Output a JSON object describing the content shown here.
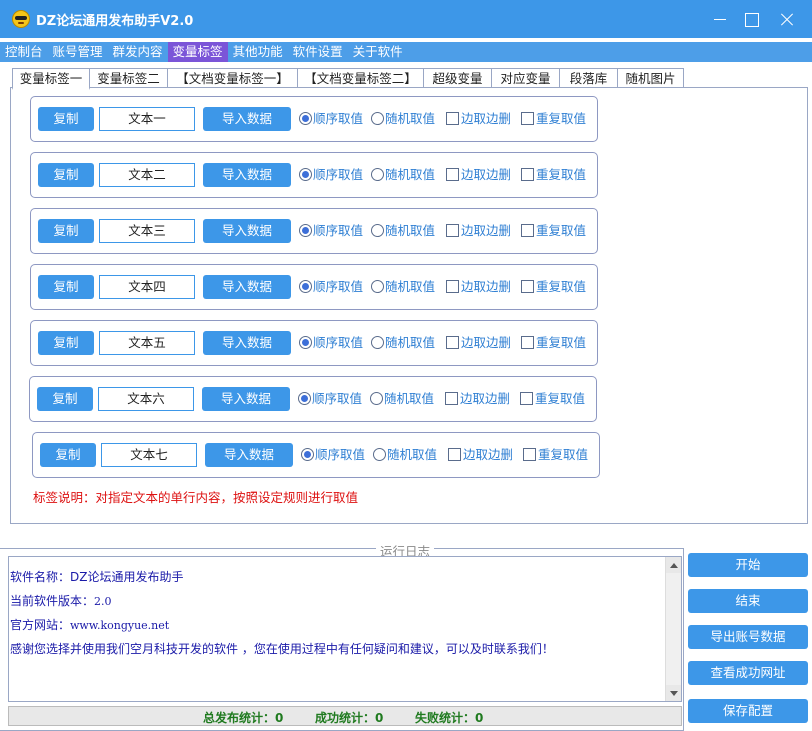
{
  "window": {
    "title": "DZ论坛通用发布助手V2.0"
  },
  "menu": [
    "控制台",
    "账号管理",
    "群发内容",
    "变量标签",
    "其他功能",
    "软件设置",
    "关于软件"
  ],
  "tabs": [
    "变量标签一",
    "变量标签二",
    "【文档变量标签一】",
    "【文档变量标签二】",
    "超级变量",
    "对应变量",
    "段落库",
    "随机图片"
  ],
  "rows": [
    {
      "copy": "复制",
      "text": "文本一",
      "import": "导入数据"
    },
    {
      "copy": "复制",
      "text": "文本二",
      "import": "导入数据"
    },
    {
      "copy": "复制",
      "text": "文本三",
      "import": "导入数据"
    },
    {
      "copy": "复制",
      "text": "文本四",
      "import": "导入数据"
    },
    {
      "copy": "复制",
      "text": "文本五",
      "import": "导入数据"
    },
    {
      "copy": "复制",
      "text": "文本六",
      "import": "导入数据"
    },
    {
      "copy": "复制",
      "text": "文本七",
      "import": "导入数据"
    }
  ],
  "options": {
    "sequential": "顺序取值",
    "random": "随机取值",
    "edges": "边取边删",
    "repeat": "重复取值"
  },
  "hint": "标签说明：对指定文本的单行内容，按照设定规则进行取值",
  "log": {
    "legend": "运行日志",
    "lines": {
      "name_label": "软件名称：",
      "name_value": "DZ论坛通用发布助手",
      "version_label": "当前软件版本：",
      "version_value": "2.0",
      "site_label": "官方网站：",
      "site_value": "www.kongyue.net",
      "thanks": "感谢您选择并使用我们空月科技开发的软件 ，您在使用过程中有任何疑问和建议，可以及时联系我们！"
    }
  },
  "stats": {
    "total_label": "总发布统计：",
    "total_value": "0",
    "success_label": "成功统计：",
    "success_value": "0",
    "fail_label": "失败统计：",
    "fail_value": "0"
  },
  "actions": {
    "start": "开始",
    "stop": "结束",
    "export": "导出账号数据",
    "view": "查看成功网址",
    "save": "保存配置"
  },
  "colors": {
    "accent": "#3d97e8",
    "menu_active": "#7b55d8",
    "hint": "#dd1111",
    "log_text": "#1a1aa8",
    "stats": "#1f7a1f"
  }
}
